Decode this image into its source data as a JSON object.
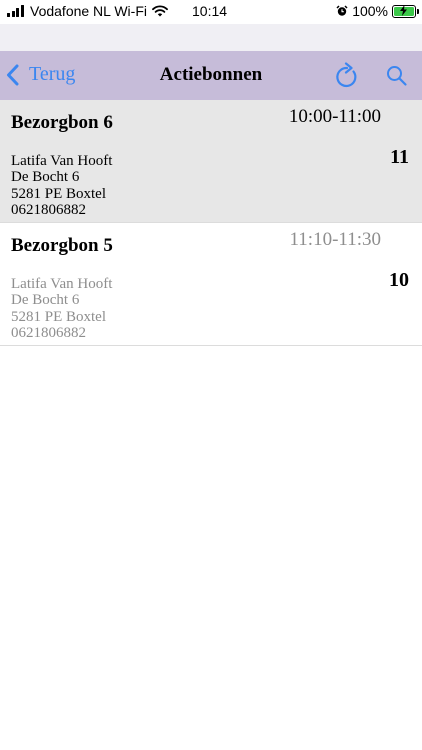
{
  "status_bar": {
    "carrier": "Vodafone NL Wi-Fi",
    "time": "10:14",
    "battery": "100%",
    "battery_level": 1.0,
    "battery_color": "#3cc84a",
    "signal_bars": 4,
    "icons": [
      "signal-icon",
      "wifi-icon",
      "alarm-icon",
      "battery-charging-icon"
    ]
  },
  "nav": {
    "back_label": "Terug",
    "title": "Actiebonnen",
    "accent_color": "#3b86f0",
    "bar_color": "#c6bcd9",
    "icons": [
      "chevron-left-icon",
      "refresh-icon",
      "search-icon"
    ]
  },
  "orders": [
    {
      "title": "Bezorgbon 6",
      "time": "10:00-11:00",
      "quantity": "11",
      "name": "Latifa Van Hooft",
      "street": "De Bocht 6",
      "city": "5281 PE Boxtel",
      "phone": "0621806882",
      "selected": true
    },
    {
      "title": "Bezorgbon 5",
      "time": "11:10-11:30",
      "quantity": "10",
      "name": "Latifa Van Hooft",
      "street": "De Bocht 6",
      "city": "5281 PE Boxtel",
      "phone": "0621806882",
      "selected": false
    }
  ]
}
